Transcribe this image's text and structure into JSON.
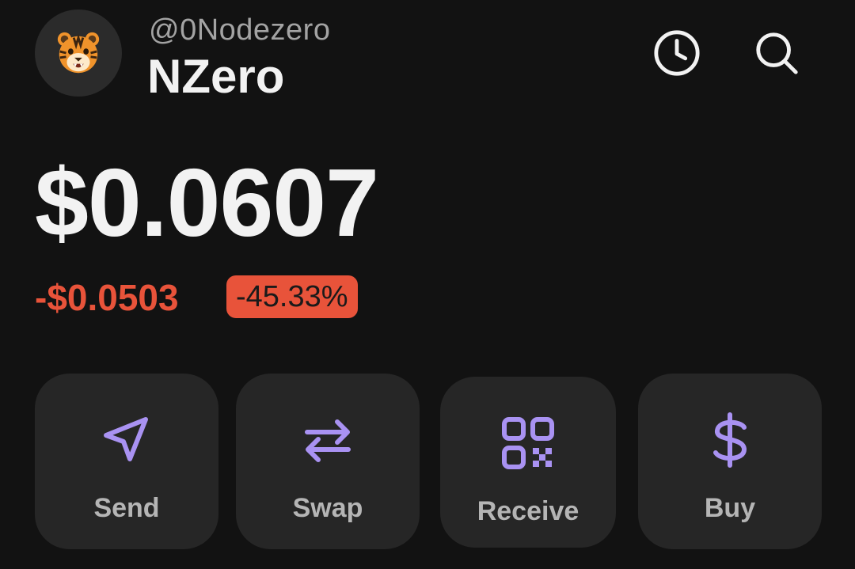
{
  "header": {
    "handle": "@0Nodezero",
    "account_name": "NZero",
    "avatar_icon": "tiger-face-icon",
    "history_icon": "clock-icon",
    "search_icon": "search-icon"
  },
  "balance": {
    "value": "$0.0607",
    "change_amount": "-$0.0503",
    "change_percent": "-45.33%",
    "negative_color": "#e8533a"
  },
  "actions": [
    {
      "label": "Send",
      "icon": "send-icon"
    },
    {
      "label": "Swap",
      "icon": "swap-arrows-icon"
    },
    {
      "label": "Receive",
      "icon": "qr-code-icon"
    },
    {
      "label": "Buy",
      "icon": "dollar-sign-icon"
    }
  ],
  "colors": {
    "background": "#121212",
    "card": "#262626",
    "accent": "#a992f2",
    "negative": "#e8533a"
  }
}
